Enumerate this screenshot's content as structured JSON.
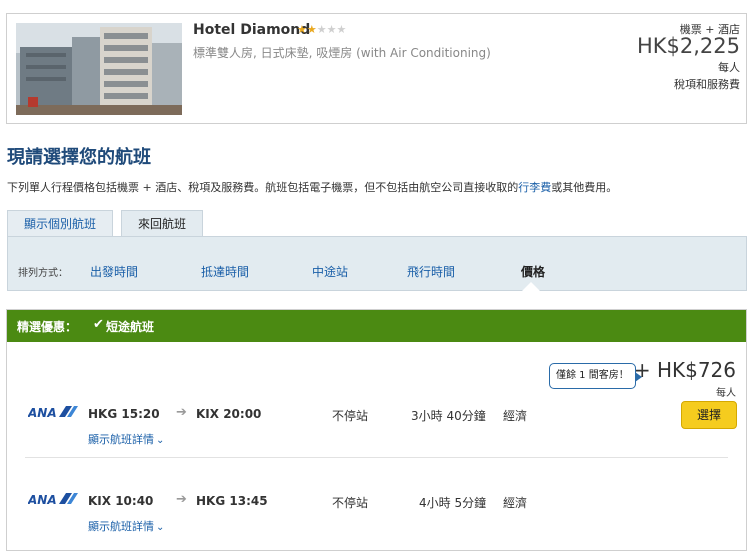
{
  "hotel": {
    "name": "Hotel Diamond",
    "rating": 2.5,
    "room": "標準雙人房, 日式床墊, 吸煙房 (with Air Conditioning)",
    "package_label": "機票 + 酒店",
    "price": "HK$2,225",
    "per_person": "每人",
    "taxes": "稅項和服務費"
  },
  "heading": {
    "title": "現請選擇您的航班",
    "info_prefix": "下列單人行程價格包括機票 + 酒店、稅項及服務費。航班包括電子機票，但不包括由航空公司直接收取的",
    "info_link": "行李費",
    "info_suffix": "或其他費用。"
  },
  "tabs": [
    {
      "label": "顯示個別航班",
      "active": false
    },
    {
      "label": "來回航班",
      "active": true
    }
  ],
  "sort": {
    "label": "排列方式：",
    "options": [
      "出發時間",
      "抵達時間",
      "中途站",
      "飛行時間",
      "價格"
    ],
    "active": "價格"
  },
  "promo": {
    "label": "精選優惠：",
    "value": "短途航班"
  },
  "offer": {
    "rooms_left": "僅餘 1 間客房！",
    "price": "+ HK$726",
    "per_person": "每人",
    "select_label": "選擇"
  },
  "flights": [
    {
      "airline": "ANA",
      "depart": "HKG 15:20",
      "arrive": "KIX 20:00",
      "stops": "不停站",
      "duration": "3小時 40分鐘",
      "cabin": "經濟",
      "details_label": "顯示航班詳情"
    },
    {
      "airline": "ANA",
      "depart": "KIX 10:40",
      "arrive": "HKG 13:45",
      "stops": "不停站",
      "duration": "4小時 5分鐘",
      "cabin": "經濟",
      "details_label": "顯示航班詳情"
    }
  ],
  "colors": {
    "promo_green": "#4b8a12",
    "link_blue": "#1a5fa8",
    "title_blue": "#1f4a7a",
    "button_yellow": "#f5cc1e",
    "ana_blue": "#1d4fa0"
  }
}
